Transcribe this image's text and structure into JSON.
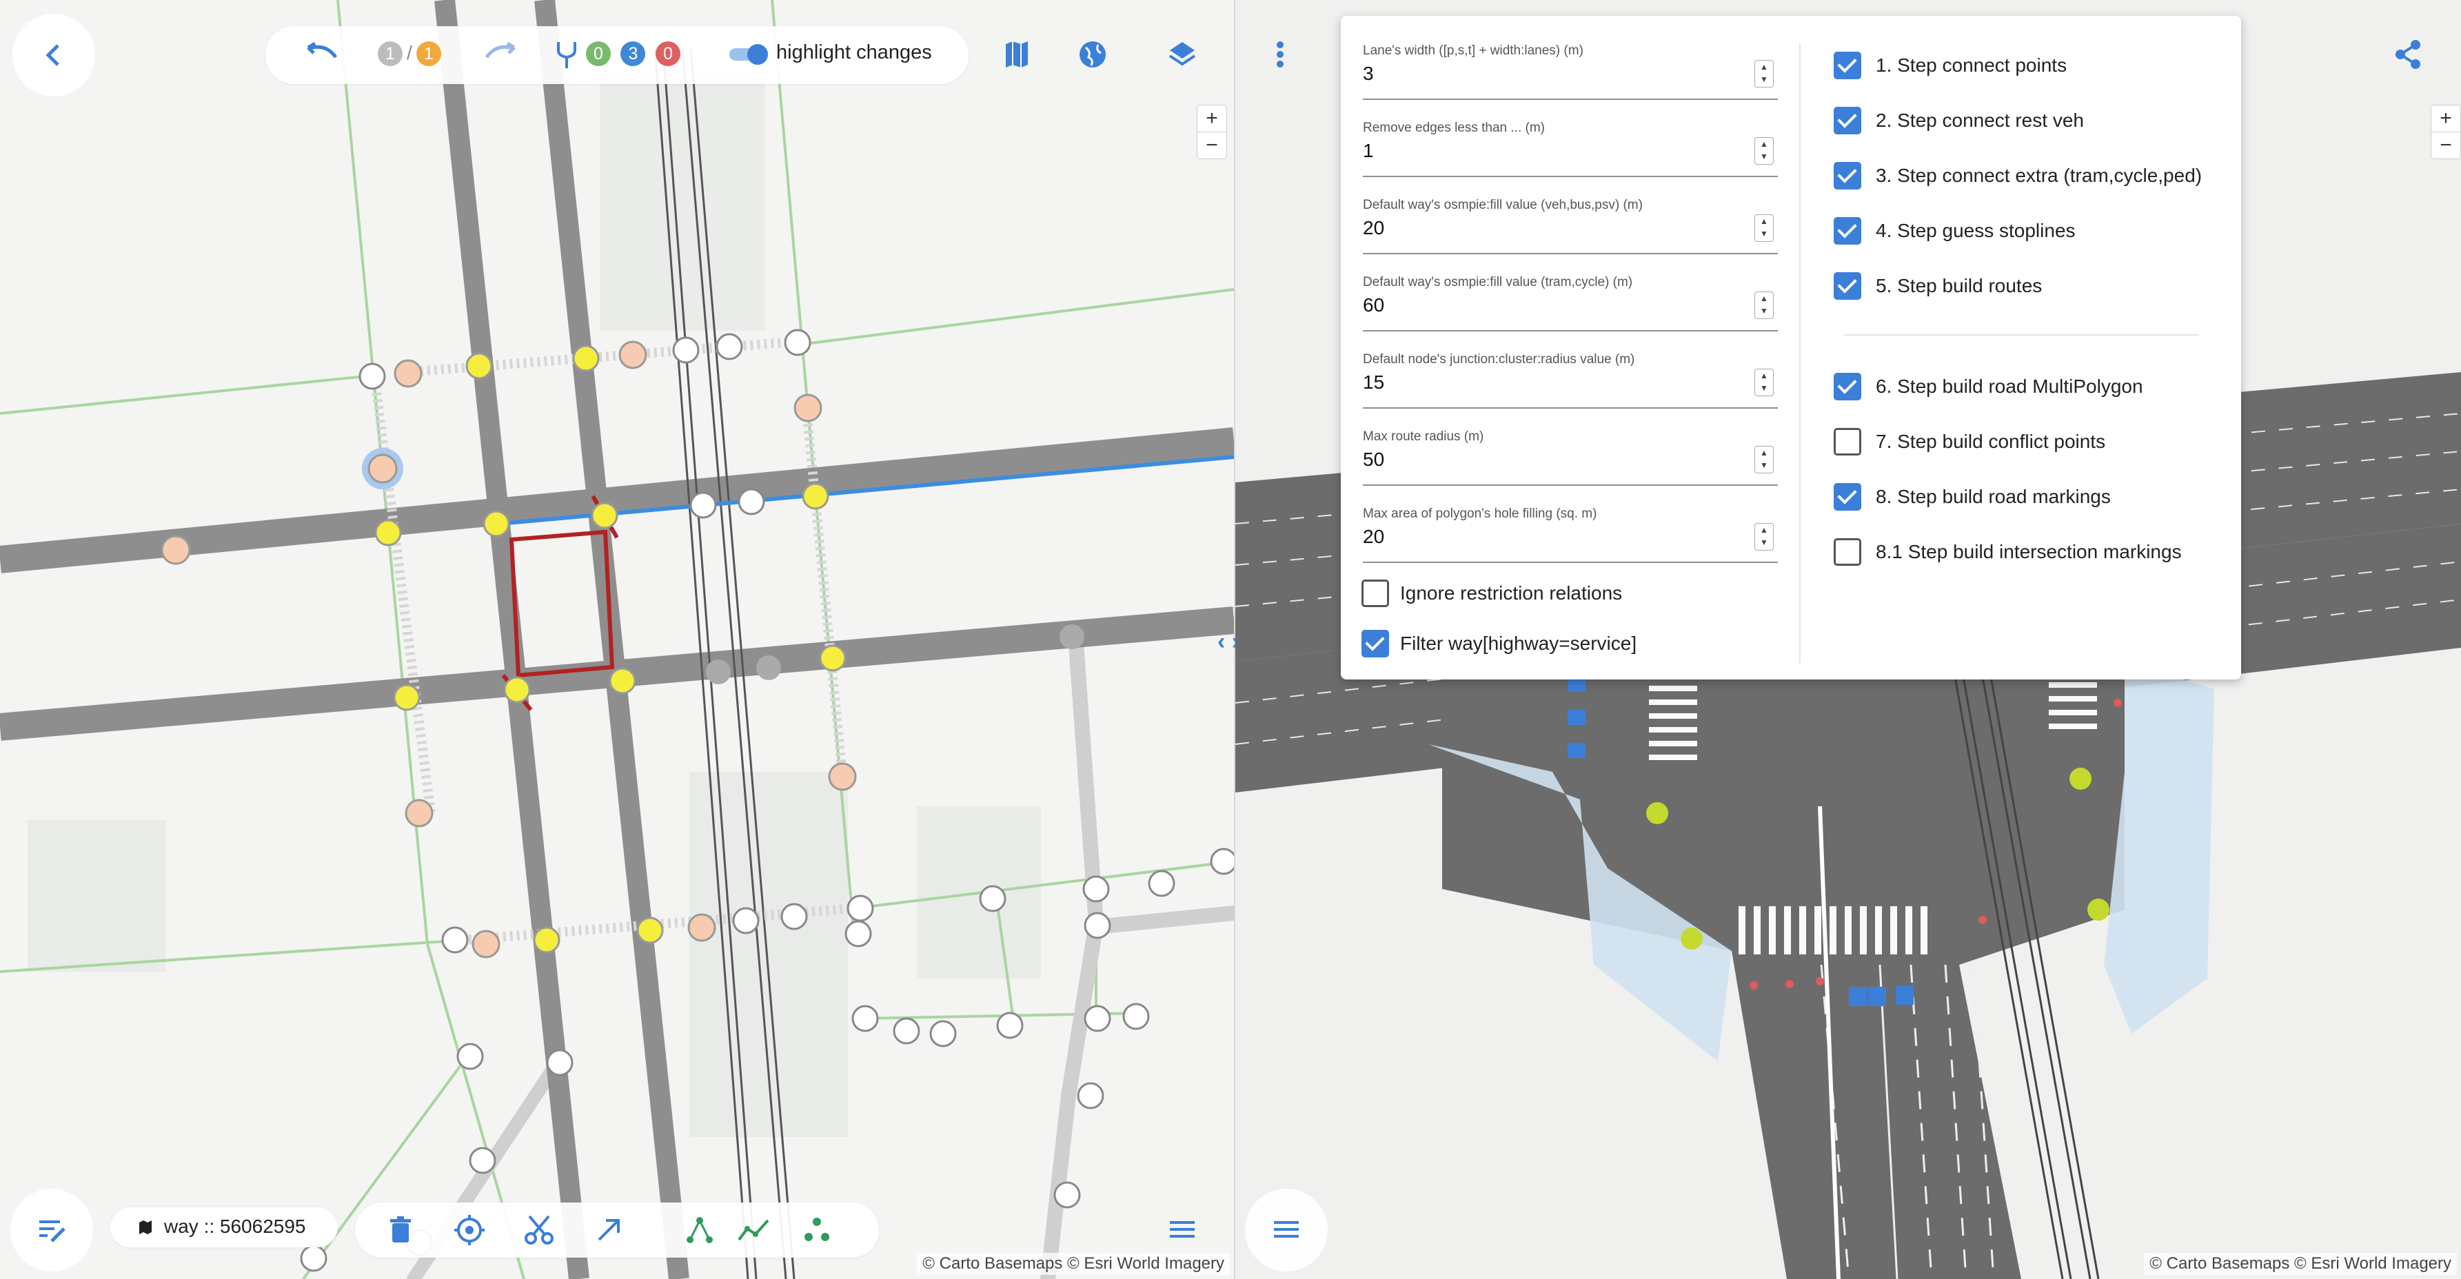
{
  "colors": {
    "accent": "#3b7fd8",
    "road": "#8e8e8e",
    "rail": "#555555",
    "green_path": "#a9d5a0",
    "selected_way": "#b22222",
    "route_line": "#3b8de0",
    "node_yellow": "#f5ee3c",
    "node_peach": "#f6cbaf",
    "badge_gray": "#bcbcbc",
    "badge_orange": "#f2a93b",
    "badge_green": "#79b86d",
    "badge_blue": "#3f88d8",
    "badge_red": "#e06060"
  },
  "top_toolbar": {
    "undo_count": "1",
    "slash": "/",
    "redo_count": "1",
    "changes": {
      "created": "0",
      "modified": "3",
      "deleted": "0"
    },
    "highlight_label": "highlight changes",
    "icons": [
      "back-chevron-icon",
      "undo-icon",
      "redo-icon",
      "branch-icon",
      "map-icon",
      "globe-icon",
      "layers-icon"
    ]
  },
  "bottom_left": {
    "way_label": "way :: 56062595",
    "tools": [
      "edit-list-icon",
      "trash-icon",
      "target-icon",
      "scissors-icon",
      "arrow-diagonal-icon",
      "nodes-icon",
      "polyline-icon",
      "cluster-icon",
      "list-icon"
    ]
  },
  "zoom": {
    "plus": "+",
    "minus": "−"
  },
  "attribution": "© Carto Basemaps © Esri World Imagery",
  "settings_panel": {
    "fields": [
      {
        "label": "Lane's width ([p,s,t] + width:lanes) (m)",
        "value": "3"
      },
      {
        "label": "Remove edges less than ... (m)",
        "value": "1"
      },
      {
        "label": "Default way's osmpie:fill value (veh,bus,psv) (m)",
        "value": "20"
      },
      {
        "label": "Default way's osmpie:fill value (tram,cycle) (m)",
        "value": "60"
      },
      {
        "label": "Default node's junction:cluster:radius value (m)",
        "value": "15"
      },
      {
        "label": "Max route radius (m)",
        "value": "50"
      },
      {
        "label": "Max area of polygon's hole filling (sq. m)",
        "value": "20"
      }
    ],
    "options": [
      {
        "label": "Ignore restriction relations",
        "checked": false
      },
      {
        "label": "Filter way[highway=service]",
        "checked": true
      }
    ],
    "steps": [
      {
        "label": "1. Step connect points",
        "checked": true
      },
      {
        "label": "2. Step connect rest veh",
        "checked": true
      },
      {
        "label": "3. Step connect extra (tram,cycle,ped)",
        "checked": true
      },
      {
        "label": "4. Step guess stoplines",
        "checked": true
      },
      {
        "label": "5. Step build routes",
        "checked": true
      },
      {
        "label": "6. Step build road MultiPolygon",
        "checked": true
      },
      {
        "label": "7. Step build conflict points",
        "checked": false
      },
      {
        "label": "8. Step build road markings",
        "checked": true
      },
      {
        "label": "8.1 Step build intersection markings",
        "checked": false
      }
    ]
  },
  "right_toolbar": {
    "icons": [
      "more-vert-icon",
      "share-icon",
      "list-icon"
    ]
  }
}
